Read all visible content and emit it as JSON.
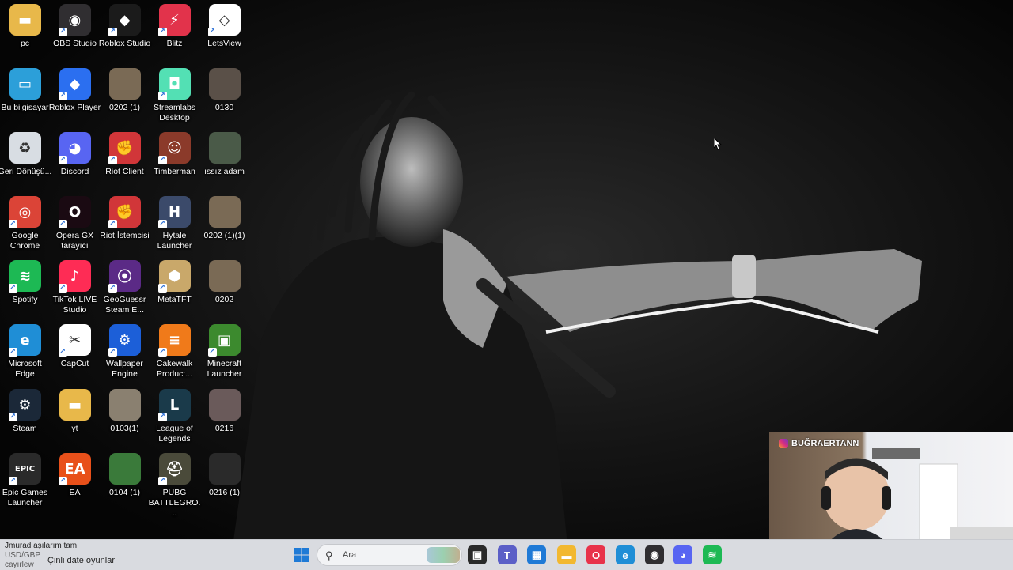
{
  "desktop": {
    "icons": [
      {
        "label": "pc",
        "icon": "folder-icon",
        "color": "#e8b84a",
        "glyph": "▬",
        "shortcut": false
      },
      {
        "label": "OBS Studio",
        "icon": "obs-icon",
        "color": "#302e31",
        "glyph": "◉",
        "shortcut": true
      },
      {
        "label": "Roblox Studio",
        "icon": "roblox-studio-icon",
        "color": "#1b1b1b",
        "glyph": "◆",
        "shortcut": true
      },
      {
        "label": "Blitz",
        "icon": "blitz-icon",
        "color": "#e2334b",
        "glyph": "⚡",
        "shortcut": true
      },
      {
        "label": "LetsView",
        "icon": "letsview-icon",
        "color": "#ffffff",
        "glyph": "◇",
        "shortcut": true
      },
      {
        "label": "Bu bilgisayar",
        "icon": "this-pc-icon",
        "color": "#2c9fd9",
        "glyph": "▭",
        "shortcut": false
      },
      {
        "label": "Roblox Player",
        "icon": "roblox-player-icon",
        "color": "#2b6ff0",
        "glyph": "◆",
        "shortcut": true
      },
      {
        "label": "0202 (1)",
        "icon": "image-thumbnail-icon",
        "color": "#7a6a55",
        "glyph": "",
        "shortcut": false
      },
      {
        "label": "Streamlabs Desktop",
        "icon": "streamlabs-icon",
        "color": "#53e0b4",
        "glyph": "◘",
        "shortcut": true
      },
      {
        "label": "0130",
        "icon": "image-thumbnail-icon",
        "color": "#5a5048",
        "glyph": "",
        "shortcut": false
      },
      {
        "label": "Geri Dönüşü...",
        "icon": "recycle-bin-icon",
        "color": "#d8dde3",
        "glyph": "♻",
        "shortcut": false
      },
      {
        "label": "Discord",
        "icon": "discord-icon",
        "color": "#5865f2",
        "glyph": "◕",
        "shortcut": true
      },
      {
        "label": "Riot Client",
        "icon": "riot-client-icon",
        "color": "#d13639",
        "glyph": "✊",
        "shortcut": true
      },
      {
        "label": "Timberman",
        "icon": "timberman-icon",
        "color": "#8b3a2a",
        "glyph": "☺",
        "shortcut": true
      },
      {
        "label": "ıssız adam",
        "icon": "image-thumbnail-icon",
        "color": "#4a5a48",
        "glyph": "",
        "shortcut": false
      },
      {
        "label": "Google Chrome",
        "icon": "chrome-icon",
        "color": "#db4437",
        "glyph": "◎",
        "shortcut": true
      },
      {
        "label": "Opera GX tarayıcı",
        "icon": "opera-gx-icon",
        "color": "#1a0a12",
        "glyph": "O",
        "shortcut": true
      },
      {
        "label": "Riot İstemcisi",
        "icon": "riot-client-icon",
        "color": "#d13639",
        "glyph": "✊",
        "shortcut": true
      },
      {
        "label": "Hytale Launcher",
        "icon": "hytale-icon",
        "color": "#3b4a6a",
        "glyph": "H",
        "shortcut": true
      },
      {
        "label": "0202 (1)(1)",
        "icon": "image-thumbnail-icon",
        "color": "#7a6a55",
        "glyph": "",
        "shortcut": false
      },
      {
        "label": "Spotify",
        "icon": "spotify-icon",
        "color": "#1db954",
        "glyph": "≋",
        "shortcut": true
      },
      {
        "label": "TikTok LIVE Studio",
        "icon": "tiktok-icon",
        "color": "#fe2c55",
        "glyph": "♪",
        "shortcut": true
      },
      {
        "label": "GeoGuessr Steam E...",
        "icon": "geoguessr-icon",
        "color": "#5b2a86",
        "glyph": "⦿",
        "shortcut": true
      },
      {
        "label": "MetaTFT",
        "icon": "metatft-icon",
        "color": "#c9a86a",
        "glyph": "⬢",
        "shortcut": true
      },
      {
        "label": "0202",
        "icon": "image-thumbnail-icon",
        "color": "#7a6a55",
        "glyph": "",
        "shortcut": false
      },
      {
        "label": "Microsoft Edge",
        "icon": "edge-icon",
        "color": "#1f8ed6",
        "glyph": "e",
        "shortcut": true
      },
      {
        "label": "CapCut",
        "icon": "capcut-icon",
        "color": "#ffffff",
        "glyph": "✂",
        "shortcut": true
      },
      {
        "label": "Wallpaper Engine",
        "icon": "wallpaper-engine-icon",
        "color": "#1c5fd8",
        "glyph": "⚙",
        "shortcut": true
      },
      {
        "label": "Cakewalk Product...",
        "icon": "cakewalk-icon",
        "color": "#f07a1a",
        "glyph": "≡",
        "shortcut": true
      },
      {
        "label": "Minecraft Launcher",
        "icon": "minecraft-icon",
        "color": "#3c8a2e",
        "glyph": "▣",
        "shortcut": true
      },
      {
        "label": "Steam",
        "icon": "steam-icon",
        "color": "#1b2838",
        "glyph": "⚙",
        "shortcut": true
      },
      {
        "label": "yt",
        "icon": "folder-icon",
        "color": "#e8b84a",
        "glyph": "▬",
        "shortcut": false
      },
      {
        "label": "0103(1)",
        "icon": "image-thumbnail-icon",
        "color": "#8a8070",
        "glyph": "",
        "shortcut": false
      },
      {
        "label": "League of Legends",
        "icon": "league-icon",
        "color": "#1a3a4a",
        "glyph": "L",
        "shortcut": true
      },
      {
        "label": "0216",
        "icon": "image-thumbnail-icon",
        "color": "#6a5a5a",
        "glyph": "",
        "shortcut": false
      },
      {
        "label": "Epic Games Launcher",
        "icon": "epic-games-icon",
        "color": "#2a2a2a",
        "glyph": "EPIC",
        "shortcut": true
      },
      {
        "label": "EA",
        "icon": "ea-icon",
        "color": "#e8501a",
        "glyph": "EA",
        "shortcut": true
      },
      {
        "label": "0104 (1)",
        "icon": "image-thumbnail-icon",
        "color": "#3a7a3a",
        "glyph": "",
        "shortcut": false
      },
      {
        "label": "PUBG BATTLEGRO...",
        "icon": "pubg-icon",
        "color": "#4a4a3a",
        "glyph": "⛑",
        "shortcut": true
      },
      {
        "label": "0216 (1)",
        "icon": "image-thumbnail-icon",
        "color": "#2a2a2a",
        "glyph": "",
        "shortcut": false
      }
    ]
  },
  "taskbar": {
    "ticker_line1": "Jmurad aşılarım tam",
    "ticker_line2": "USD/GBP",
    "ticker_line3": "cayırlew",
    "widget_text": "Çinli date oyunları",
    "search_placeholder": "Ara",
    "apps": [
      {
        "name": "widgets-icon",
        "color": "#c9b58a",
        "glyph": "☀"
      },
      {
        "name": "task-view-icon",
        "color": "#2a2a2a",
        "glyph": "▣"
      },
      {
        "name": "teams-icon",
        "color": "#5b5fc7",
        "glyph": "T"
      },
      {
        "name": "store-icon",
        "color": "#1f7ad6",
        "glyph": "▦"
      },
      {
        "name": "file-explorer-icon",
        "color": "#f2b830",
        "glyph": "▬"
      },
      {
        "name": "opera-gx-icon",
        "color": "#e8334a",
        "glyph": "O"
      },
      {
        "name": "edge-icon",
        "color": "#1f8ed6",
        "glyph": "e"
      },
      {
        "name": "obs-icon",
        "color": "#302e31",
        "glyph": "◉"
      },
      {
        "name": "discord-icon",
        "color": "#5865f2",
        "glyph": "◕"
      },
      {
        "name": "spotify-icon",
        "color": "#1db954",
        "glyph": "≋"
      }
    ]
  },
  "webcam": {
    "handle": "BUĞRAERTANN"
  },
  "colors": {
    "taskbar_bg": "#d9dbe0",
    "windows_logo": "#1e7ad6"
  }
}
